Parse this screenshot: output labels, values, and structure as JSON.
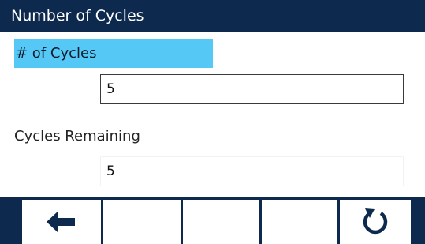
{
  "title": "Number of Cycles",
  "fields": {
    "cycles": {
      "label": "# of Cycles",
      "value": "5"
    },
    "cycles_remaining": {
      "label": "Cycles Remaining",
      "value": "5"
    }
  },
  "softkeys": [
    {
      "icon": "left-arrow-icon"
    },
    {
      "icon": ""
    },
    {
      "icon": ""
    },
    {
      "icon": ""
    },
    {
      "icon": "refresh-icon"
    }
  ],
  "colors": {
    "title_bar": "#0d2a4e",
    "selection": "#55c8f6",
    "softkey_bar": "#0d2a4e"
  }
}
